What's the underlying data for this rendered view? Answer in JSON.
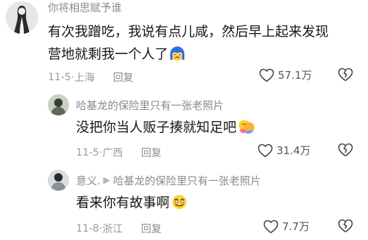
{
  "comments": [
    {
      "username": "你将相思赋予谁",
      "text_line1": "有次我蹭吃，我说有点儿咸，然后早上起来发现",
      "text_line2": "营地就剩我一个人了",
      "date": "11-5",
      "location": "上海",
      "reply_label": "回复",
      "likes": "57.1万",
      "emoji_icon": "crying-face-emoji-icon"
    },
    {
      "username": "哈基龙的保险里只有一张老照片",
      "text": "没把你当人贩子揍就知足吧",
      "date": "11-5",
      "location": "广西",
      "reply_label": "回复",
      "likes": "31.4万",
      "emoji_icon": "hug-emoji-icon"
    },
    {
      "username": "意义.",
      "reply_to": "哈基龙的保险里只有一张老照片",
      "text": "看来你有故事啊",
      "date": "11-8",
      "location": "浙江",
      "reply_label": "回复",
      "likes": "7.7万",
      "emoji_icon": "smirk-face-emoji-icon"
    }
  ],
  "colors": {
    "text": "#161616",
    "meta": "#9a9a9a",
    "name": "#8a8a8a"
  }
}
